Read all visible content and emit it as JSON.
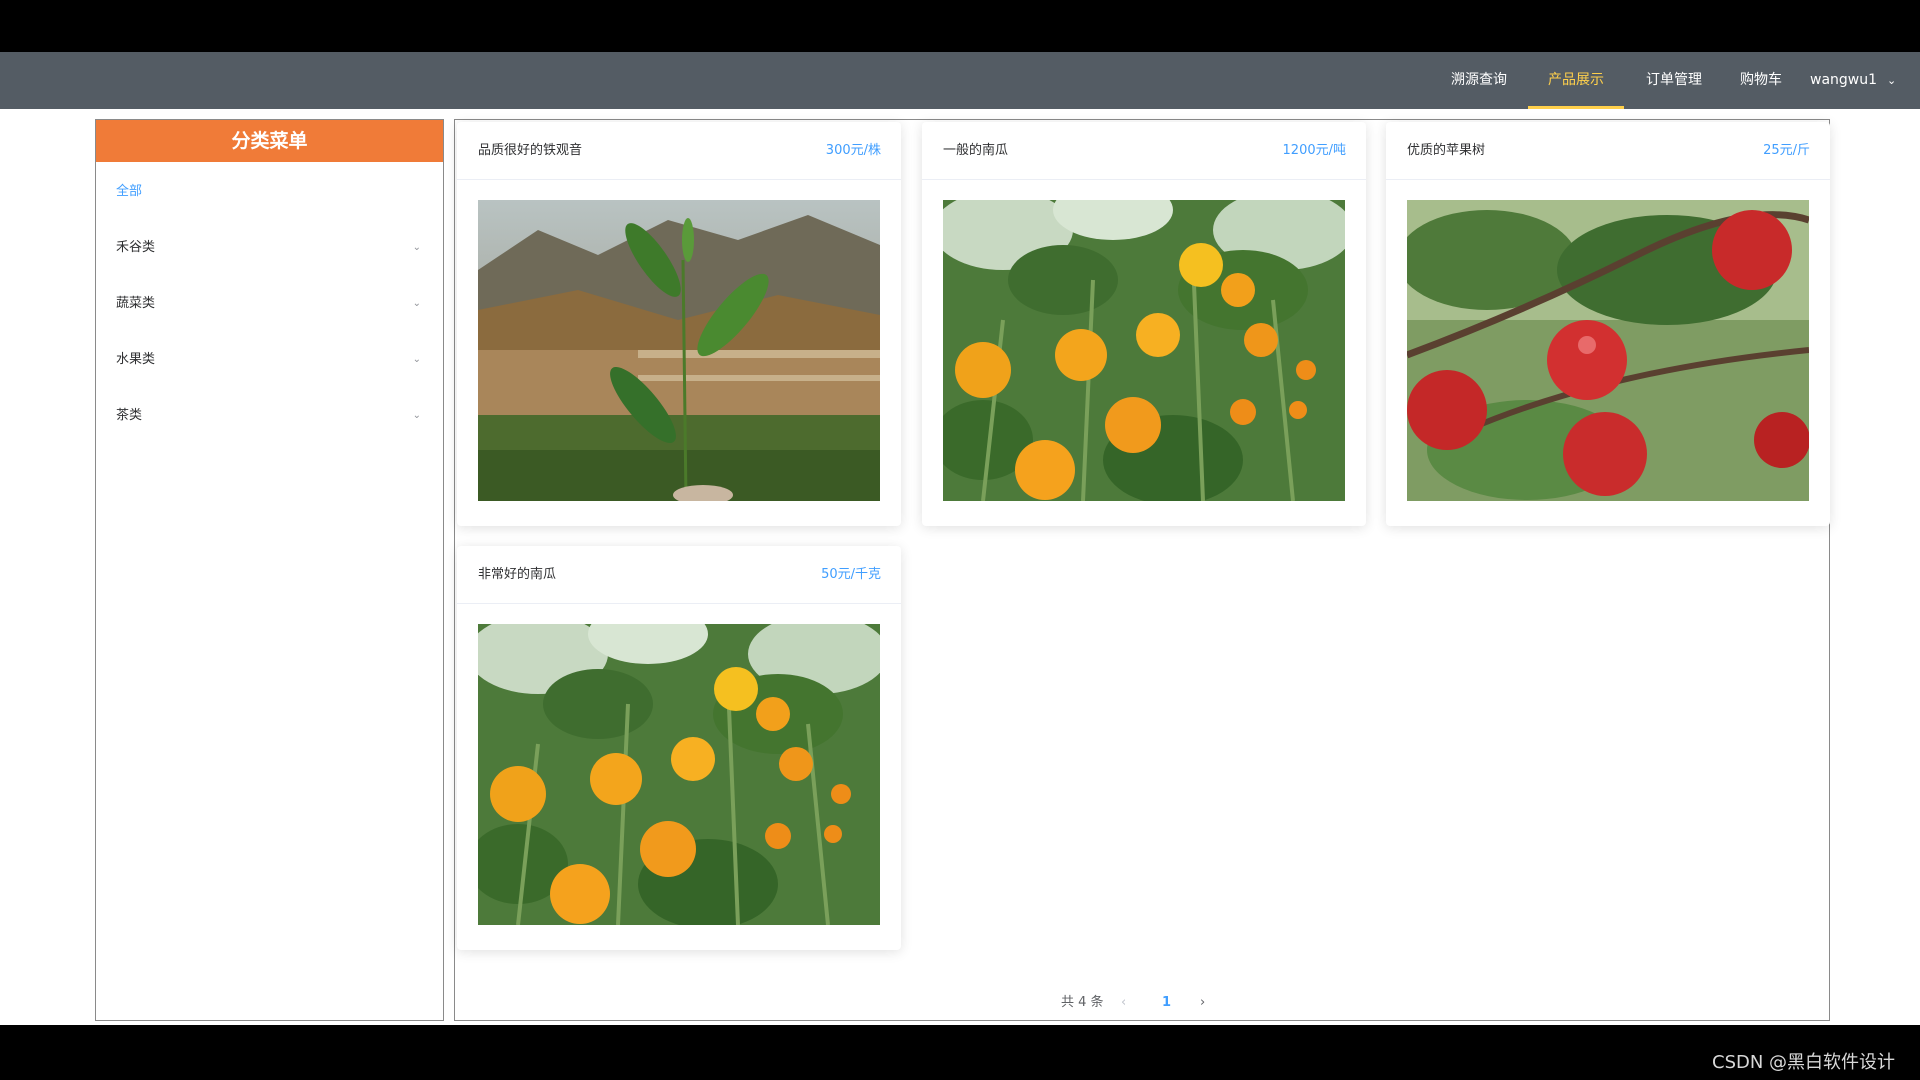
{
  "nav": {
    "items": [
      {
        "label": "溯源查询"
      },
      {
        "label": "产品展示"
      },
      {
        "label": "订单管理"
      },
      {
        "label": "购物车"
      }
    ],
    "active_index": 1,
    "user": "wangwu1",
    "user_icon": "chevron-down-icon"
  },
  "sidebar": {
    "title": "分类菜单",
    "items": [
      {
        "label": "全部",
        "active": true
      },
      {
        "label": "禾谷类",
        "icon": "chevron-down-icon"
      },
      {
        "label": "蔬菜类",
        "icon": "chevron-down-icon"
      },
      {
        "label": "水果类",
        "icon": "chevron-down-icon"
      },
      {
        "label": "茶类",
        "icon": "chevron-down-icon"
      }
    ]
  },
  "products": [
    {
      "name": "品质很好的铁观音",
      "price": "300元/株",
      "image": "tea-leaf-photo"
    },
    {
      "name": "一般的南瓜",
      "price": "1200元/吨",
      "image": "pumpkin-field-photo"
    },
    {
      "name": "优质的苹果树",
      "price": "25元/斤",
      "image": "apple-tree-photo"
    },
    {
      "name": "非常好的南瓜",
      "price": "50元/千克",
      "image": "pumpkin-field-photo"
    }
  ],
  "pagination": {
    "total_text": "共 4 条",
    "current_page": "1",
    "prev_icon": "chevron-left-icon",
    "next_icon": "chevron-right-icon"
  },
  "watermark": "CSDN @黑白软件设计",
  "colors": {
    "navbar_bg": "#545c64",
    "nav_active": "#ffd04b",
    "sidebar_header": "#f07b38",
    "link_blue": "#409eff"
  }
}
